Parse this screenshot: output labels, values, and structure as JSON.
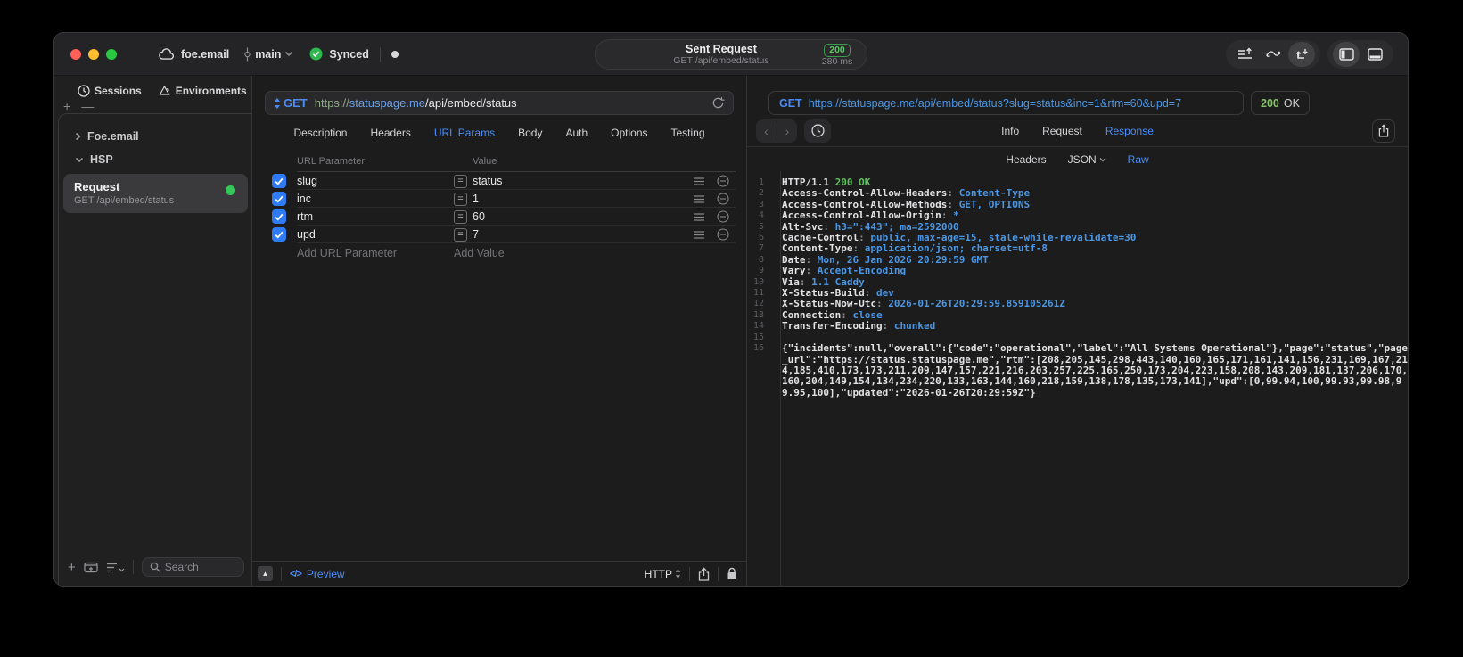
{
  "colors": {
    "accent": "#4b8df8",
    "code_blue": "#4b97e4",
    "green": "#5ec25e",
    "checkbox_blue": "#2f7bf5",
    "status_dot_green": "#34c759"
  },
  "titlebar": {
    "project": "foe.email",
    "branch": "main",
    "sync_status": "Synced",
    "request_title": "Sent Request",
    "request_subtitle": "GET /api/embed/status",
    "status_code": "200",
    "duration": "280 ms"
  },
  "sidebar": {
    "tabs": [
      {
        "label": "Sessions"
      },
      {
        "label": "Environments"
      }
    ],
    "tree": [
      {
        "label": "Foe.email",
        "expanded": false
      },
      {
        "label": "HSP",
        "expanded": true
      }
    ],
    "request_item": {
      "title": "Request",
      "subtitle": "GET /api/embed/status"
    },
    "search_placeholder": "Search"
  },
  "request_panel": {
    "method": "GET",
    "url_scheme": "https://",
    "url_host": "statuspage.me",
    "url_path": "/api/embed/status",
    "tabs": [
      "Description",
      "Headers",
      "URL Params",
      "Body",
      "Auth",
      "Options",
      "Testing"
    ],
    "active_tab": "URL Params",
    "params": {
      "col_name": "URL Parameter",
      "col_value": "Value",
      "rows": [
        {
          "name": "slug",
          "value": "status",
          "enabled": true
        },
        {
          "name": "inc",
          "value": "1",
          "enabled": true
        },
        {
          "name": "rtm",
          "value": "60",
          "enabled": true
        },
        {
          "name": "upd",
          "value": "7",
          "enabled": true
        }
      ],
      "add_name_placeholder": "Add URL Parameter",
      "add_value_placeholder": "Add Value"
    },
    "footer": {
      "preview_label": "Preview",
      "code_glyph": "</>",
      "protocol": "HTTP"
    }
  },
  "response_panel": {
    "method": "GET",
    "url": "https://statuspage.me/api/embed/status?slug=status&inc=1&rtm=60&upd=7",
    "status_code": "200",
    "status_text": "OK",
    "tabs": [
      "Info",
      "Request",
      "Response"
    ],
    "active_tab": "Response",
    "subtabs": [
      "Headers",
      "JSON",
      "Raw"
    ],
    "active_subtab": "Raw",
    "status_line": {
      "protocol": "HTTP/1.1",
      "status": "200 OK"
    },
    "headers": [
      {
        "key": "Access-Control-Allow-Headers",
        "value": "Content-Type"
      },
      {
        "key": "Access-Control-Allow-Methods",
        "value": "GET, OPTIONS"
      },
      {
        "key": "Access-Control-Allow-Origin",
        "value": "*"
      },
      {
        "key": "Alt-Svc",
        "value": "h3=\":443\"; ma=2592000"
      },
      {
        "key": "Cache-Control",
        "value": "public, max-age=15, stale-while-revalidate=30"
      },
      {
        "key": "Content-Type",
        "value": "application/json; charset=utf-8"
      },
      {
        "key": "Date",
        "value": "Mon, 26 Jan 2026 20:29:59 GMT"
      },
      {
        "key": "Vary",
        "value": "Accept-Encoding"
      },
      {
        "key": "Via",
        "value": "1.1 Caddy"
      },
      {
        "key": "X-Status-Build",
        "value": "dev"
      },
      {
        "key": "X-Status-Now-Utc",
        "value": "2026-01-26T20:29:59.859105261Z"
      },
      {
        "key": "Connection",
        "value": "close"
      },
      {
        "key": "Transfer-Encoding",
        "value": "chunked"
      }
    ],
    "body": "{\"incidents\":null,\"overall\":{\"code\":\"operational\",\"label\":\"All Systems Operational\"},\"page\":\"status\",\"page_url\":\"https://status.statuspage.me\",\"rtm\":[208,205,145,298,443,140,160,165,171,161,141,156,231,169,167,214,185,410,173,173,211,209,147,157,221,216,203,257,225,165,250,173,204,223,158,208,143,209,181,137,206,170,160,204,149,154,134,234,220,133,163,144,160,218,159,138,178,135,173,141],\"upd\":[0,99.94,100,99.93,99.98,99.95,100],\"updated\":\"2026-01-26T20:29:59Z\"}"
  }
}
